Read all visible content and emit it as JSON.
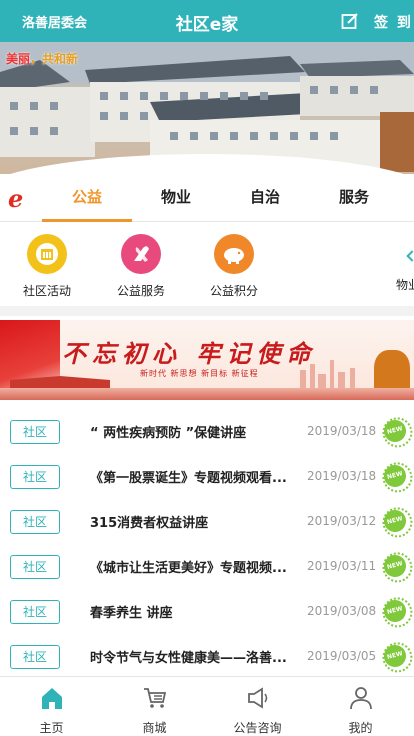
{
  "header": {
    "org": "洛善居委会",
    "title": "社区e家",
    "sign_label": "签 到"
  },
  "banner": {
    "slogan_part1": "美丽",
    "slogan_part2": "共和新"
  },
  "tabs": {
    "logo": "e",
    "items": [
      {
        "label": "公益",
        "active": true
      },
      {
        "label": "物业",
        "active": false
      },
      {
        "label": "自治",
        "active": false
      },
      {
        "label": "服务",
        "active": false
      }
    ]
  },
  "categories": [
    {
      "label": "社区活动",
      "icon": "building-icon",
      "color": "#f2c21a"
    },
    {
      "label": "公益服务",
      "icon": "heart-ribbon-icon",
      "color": "#e84a7d"
    },
    {
      "label": "公益积分",
      "icon": "piggy-bank-icon",
      "color": "#f0882a"
    },
    {
      "label": "物业"
    }
  ],
  "party_banner": {
    "title": "不忘初心 牢记使命",
    "subtitle": "新时代 新思想 新目标 新征程"
  },
  "news": [
    {
      "tag": "社区",
      "title": "“ 两性疾病预防 ”保健讲座",
      "date": "2019/03/18",
      "badge": "NEW"
    },
    {
      "tag": "社区",
      "title": "《第一股票诞生》专题视频观看...",
      "date": "2019/03/18",
      "badge": "NEW"
    },
    {
      "tag": "社区",
      "title": "315消费者权益讲座",
      "date": "2019/03/12",
      "badge": "NEW"
    },
    {
      "tag": "社区",
      "title": "《城市让生活更美好》专题视频...",
      "date": "2019/03/11",
      "badge": "NEW"
    },
    {
      "tag": "社区",
      "title": "春季养生 讲座",
      "date": "2019/03/08",
      "badge": "NEW"
    },
    {
      "tag": "社区",
      "title": "时令节气与女性健康美——洛善...",
      "date": "2019/03/05",
      "badge": "NEW"
    }
  ],
  "bottom_nav": [
    {
      "label": "主页",
      "icon": "home-icon",
      "active": true
    },
    {
      "label": "商城",
      "icon": "cart-icon",
      "active": false
    },
    {
      "label": "公告咨询",
      "icon": "megaphone-icon",
      "active": false
    },
    {
      "label": "我的",
      "icon": "user-icon",
      "active": false
    }
  ],
  "colors": {
    "accent": "#2fb3b9",
    "tab_active": "#f0952a",
    "new_badge": "#7fc93b"
  }
}
